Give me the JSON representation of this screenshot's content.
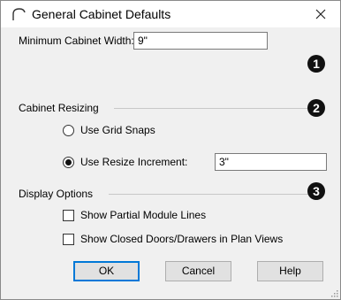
{
  "window": {
    "title": "General Cabinet Defaults",
    "close_glyph": "✕"
  },
  "min_width": {
    "label": "Minimum Cabinet Width:",
    "value": "9\"",
    "badge": "1"
  },
  "resizing": {
    "section_label": "Cabinet Resizing",
    "badge": "2",
    "options": [
      {
        "label": "Use Grid Snaps",
        "selected": false
      },
      {
        "label": "Use Resize Increment:",
        "selected": true
      }
    ],
    "increment_value": "3\""
  },
  "display": {
    "section_label": "Display Options",
    "badge": "3",
    "checkboxes": [
      {
        "label": "Show Partial Module Lines",
        "checked": false
      },
      {
        "label": "Show Closed Doors/Drawers in Plan Views",
        "checked": false
      }
    ]
  },
  "buttons": {
    "ok": "OK",
    "cancel": "Cancel",
    "help": "Help"
  },
  "colors": {
    "accent": "#0078d7",
    "badge_bg": "#111111",
    "dialog_bg": "#f0f0f0"
  }
}
